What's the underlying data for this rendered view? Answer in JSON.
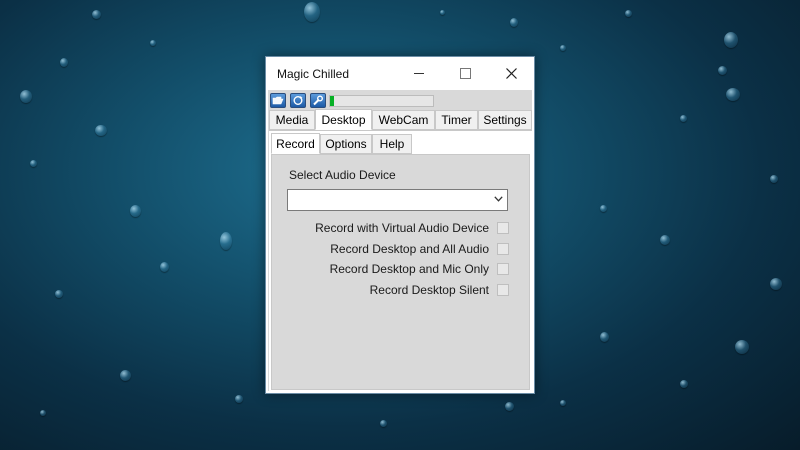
{
  "window": {
    "title": "Magic Chilled",
    "minimize_icon": "minimize-icon",
    "maximize_icon": "maximize-icon",
    "close_icon": "close-icon"
  },
  "toolbar": {
    "icons": [
      "folder-icon",
      "refresh-globe-icon",
      "wrench-icon"
    ],
    "progress_fraction": 0.04,
    "progress_color": "#06b025"
  },
  "main_tabs": [
    {
      "label": "Media",
      "active": false
    },
    {
      "label": "Desktop",
      "active": true
    },
    {
      "label": "WebCam",
      "active": false
    },
    {
      "label": "Timer",
      "active": false
    },
    {
      "label": "Settings",
      "active": false
    }
  ],
  "sub_tabs": [
    {
      "label": "Record",
      "active": true
    },
    {
      "label": "Options",
      "active": false
    },
    {
      "label": "Help",
      "active": false
    }
  ],
  "record": {
    "device_label": "Select Audio Device",
    "device_value": "",
    "options": [
      {
        "label": "Record with Virtual Audio Device",
        "checked": false
      },
      {
        "label": "Record Desktop and All Audio",
        "checked": false
      },
      {
        "label": "Record Desktop and Mic Only",
        "checked": false
      },
      {
        "label": "Record Desktop Silent",
        "checked": false
      }
    ]
  },
  "colors": {
    "panel_bg": "#d9d9d9",
    "wallpaper_accent": "#1e6f90"
  }
}
